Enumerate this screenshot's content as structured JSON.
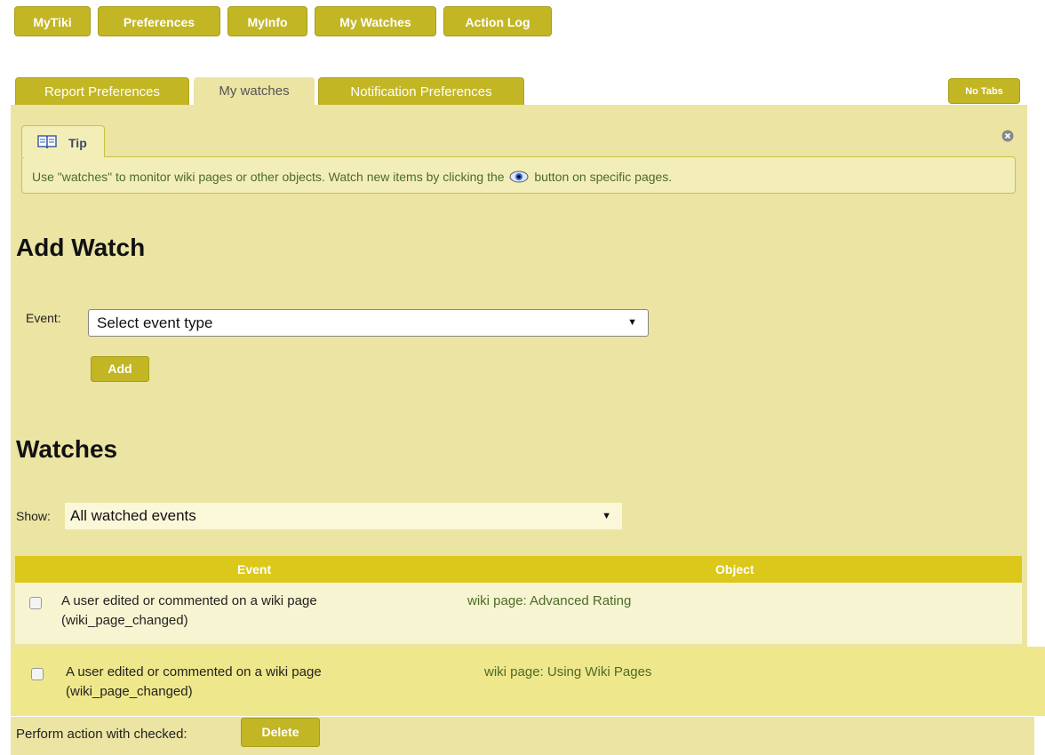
{
  "top_nav": [
    "MyTiki",
    "Preferences",
    "MyInfo",
    "My Watches",
    "Action Log"
  ],
  "tabs": [
    "Report Preferences",
    "My watches",
    "Notification Preferences"
  ],
  "no_tabs_label": "No Tabs",
  "tip": {
    "title": "Tip",
    "text_before": "Use \"watches\" to monitor wiki pages or other objects. Watch new items by clicking the",
    "text_after": "button on specific pages."
  },
  "add_watch": {
    "heading": "Add Watch",
    "event_label": "Event:",
    "event_select_value": "Select event type",
    "add_button": "Add"
  },
  "watches": {
    "heading": "Watches",
    "show_label": "Show:",
    "show_select_value": "All watched events",
    "columns": [
      "Event",
      "Object"
    ],
    "rows": [
      {
        "event": "A user edited or commented on a wiki page",
        "event_code": "(wiki_page_changed)",
        "object": "wiki page: Advanced Rating"
      },
      {
        "event": "A user edited or commented on a wiki page",
        "event_code": "(wiki_page_changed)",
        "object": "wiki page: Using Wiki Pages"
      }
    ],
    "action_label": "Perform action with checked:",
    "delete_button": "Delete"
  },
  "colors": {
    "accent": "#c3b625",
    "panel_bg": "#ebe4a3",
    "table_header": "#dcc81a",
    "link_green": "#4b6b2a"
  },
  "icons": [
    "book-icon",
    "close-circle-icon",
    "eye-icon",
    "dropdown-arrow-icon"
  ]
}
